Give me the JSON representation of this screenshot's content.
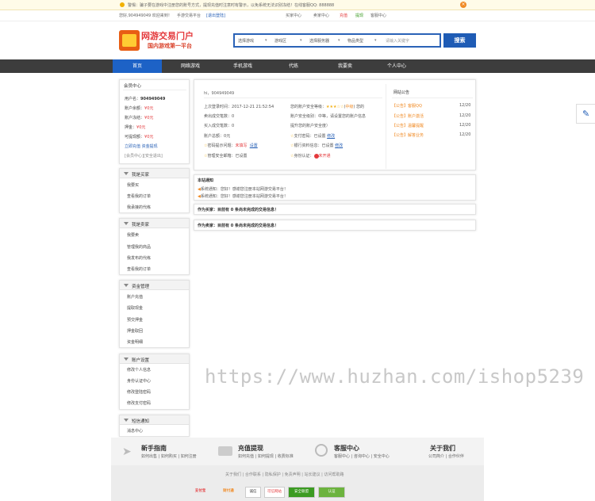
{
  "notice": {
    "text": "警惕：骗子要在游戏中注册您的账号方式，提现充值时注意时有警示，以免系统无法识别冻结！在线客服QQ: 888888"
  },
  "topbar": {
    "user": "您好,904949049 欢迎来到！",
    "platform": "手游交易平台",
    "logout": "[退出登陆]",
    "buyer_center": "买家中心",
    "seller_center": "卖家中心",
    "recharge": "充值",
    "withdraw": "提现",
    "service": "客服中心"
  },
  "logo": {
    "title": "网游交易门户",
    "subtitle": "国内游戏第一平台"
  },
  "search": {
    "game": "选择游戏",
    "area": "游戏区",
    "server": "选择服务器",
    "type": "物品类型",
    "placeholder": "请输入关键字",
    "button": "搜索"
  },
  "nav": [
    "首页",
    "网络游戏",
    "手机游戏",
    "代练",
    "我要卖",
    "个人中心"
  ],
  "member": {
    "title": "会员中心",
    "username_label": "用户名：",
    "username": "904949049",
    "balance_label": "账户余额：",
    "balance": "¥0元",
    "frozen_label": "账户冻结：",
    "frozen": "¥0元",
    "deposit_label": "押金：",
    "deposit": "¥0元",
    "points_label": "可提现额：",
    "points": "¥0元",
    "link1": "立即充值",
    "link2": "资金提现",
    "link3": "[会员中心]",
    "link4": "[安全退出]"
  },
  "menus": [
    {
      "title": "我是买家",
      "items": [
        "我要买",
        "查看我的订单",
        "我承接的代练"
      ]
    },
    {
      "title": "我是卖家",
      "items": [
        "我要卖",
        "管理我的商品",
        "我发布的代练",
        "查看我的订单"
      ]
    },
    {
      "title": "资金管理",
      "items": [
        "账户充值",
        "提取现金",
        "预交押金",
        "押金取回",
        "资金明细"
      ]
    },
    {
      "title": "账户设置",
      "items": [
        "修改个人信息",
        "身份认证中心",
        "修改登陆密码",
        "修改支付密码"
      ]
    },
    {
      "title": "短信通知",
      "items": [
        "消息中心"
      ]
    }
  ],
  "profile": {
    "greeting": "hi，904949049",
    "last_login_label": "上次登录时间：",
    "last_login": "2017-12-21 21:52:54",
    "sold_label": "卖出成交笔数：",
    "sold": "0",
    "bought_label": "买入成交笔数：",
    "bought": "0",
    "balance_label": "账户总额：",
    "balance": "0元",
    "pwd_label": "密码提示问题：",
    "pwd_status": "未填写",
    "pwd_link": "设置",
    "mgmt_label": "管理安全邮箱：",
    "mgmt_status": "已设置",
    "security_label": "您的账户安全等级：",
    "security_level": "中级",
    "security_suffix": "您的",
    "security_desc1": "账户安全级别：中等，请设置您的账户信息",
    "security_desc2": "提升您的账户安全度）",
    "paypwd_label": "支付密码：",
    "paypwd_status": "已设置",
    "paypwd_link": "修改",
    "bank_label": "银行资料信息：",
    "bank_status": "已设置",
    "bank_link": "修改",
    "id_label": "身份认证：",
    "id_status": "未开通"
  },
  "announce": {
    "title": "网站公告",
    "items": [
      {
        "tag": "【公告】",
        "text": "客服QQ",
        "date": "12/20"
      },
      {
        "tag": "【公告】",
        "text": "账户激活",
        "date": "12/20"
      },
      {
        "tag": "【公告】",
        "text": "温馨提醒",
        "date": "12/20"
      },
      {
        "tag": "【公告】",
        "text": "解答业务",
        "date": "12/20"
      }
    ]
  },
  "site_notice": {
    "title": "本站通知",
    "items": [
      {
        "tag": "系统通知",
        "text": "：您好！感谢您注册本站网游交易平台！"
      },
      {
        "tag": "系统通知",
        "text": "：您好！感谢您注册本站网游交易平台！"
      }
    ]
  },
  "buyer_bar": "作为买家：目前有 0 条尚未完成的交易信息！",
  "seller_bar": "作为卖家：目前有 0 条尚未完成的交易信息！",
  "watermark": "https://www.huzhan.com/ishop5239",
  "footer": {
    "cols": [
      {
        "title": "新手指南",
        "links": [
          "如何出售",
          "如何购买",
          "如何注册"
        ]
      },
      {
        "title": "充值提现",
        "links": [
          "如何充值",
          "如何提现",
          "收费标准"
        ]
      },
      {
        "title": "客服中心",
        "links": [
          "客服中心",
          "咨询中心",
          "安全中心"
        ]
      },
      {
        "title": "关于我们",
        "links": [
          "公司简介",
          "合作伙伴"
        ]
      }
    ],
    "links": [
      "关于我们",
      "合作联系",
      "隐私保护",
      "免责声明",
      "站长建议",
      "访问帮助路"
    ],
    "badges": [
      "支付宝",
      "财付通",
      "诚信",
      "可信网站",
      "安全联盟",
      "认证"
    ]
  }
}
